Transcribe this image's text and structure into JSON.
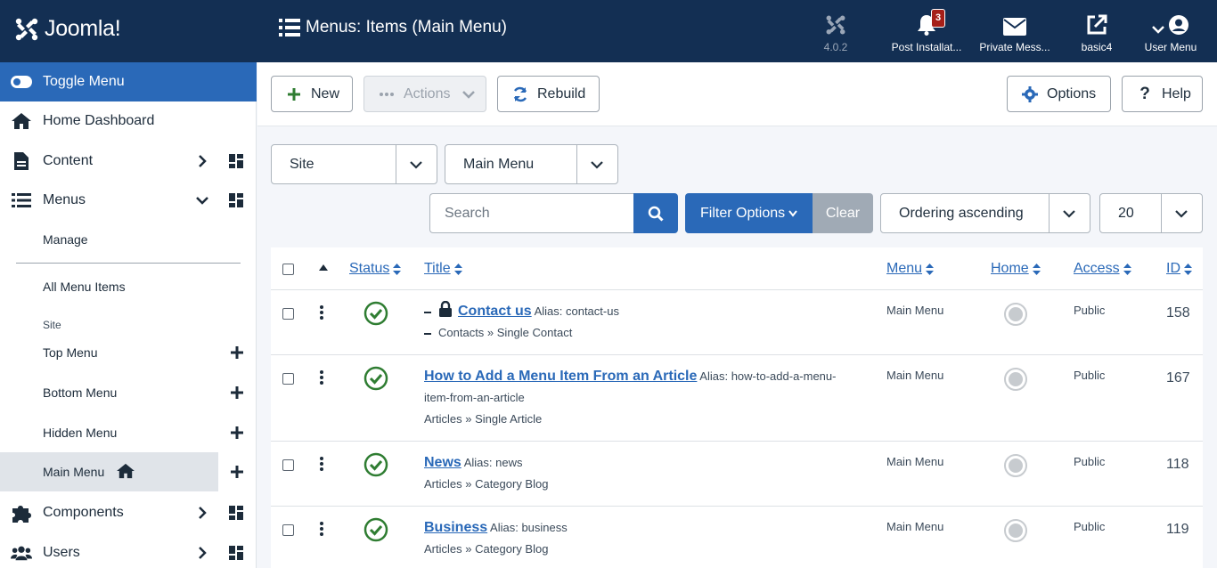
{
  "header": {
    "logo_text": "Joomla!",
    "page_title": "Menus: Items (Main Menu)",
    "items": [
      {
        "label": "4.0.2",
        "icon": "joomla-icon"
      },
      {
        "label": "Post Installat...",
        "icon": "bell-icon",
        "badge": "3"
      },
      {
        "label": "Private Mess...",
        "icon": "envelope-icon"
      },
      {
        "label": "basic4",
        "icon": "external-link-icon"
      },
      {
        "label": "User Menu",
        "icon": "user-icon"
      }
    ]
  },
  "sidebar": {
    "toggle_label": "Toggle Menu",
    "items": [
      {
        "label": "Home Dashboard",
        "icon": "home-icon"
      },
      {
        "label": "Content",
        "icon": "file-icon"
      },
      {
        "label": "Menus",
        "icon": "list-icon"
      },
      {
        "label": "Components",
        "icon": "puzzle-icon"
      },
      {
        "label": "Users",
        "icon": "users-icon"
      }
    ],
    "sub": {
      "manage": "Manage",
      "all_items": "All Menu Items",
      "site_heading": "Site",
      "menus": [
        "Top Menu",
        "Bottom Menu",
        "Hidden Menu",
        "Main Menu"
      ]
    }
  },
  "toolbar": {
    "new": "New",
    "actions": "Actions",
    "rebuild": "Rebuild",
    "options": "Options",
    "help": "Help"
  },
  "filters": {
    "client": "Site",
    "menu": "Main Menu",
    "search_placeholder": "Search",
    "filter_options": "Filter Options",
    "clear": "Clear",
    "ordering": "Ordering ascending",
    "limit": "20"
  },
  "table": {
    "headers": {
      "status": "Status",
      "title": "Title",
      "menu": "Menu",
      "home": "Home",
      "access": "Access",
      "id": "ID"
    },
    "rows": [
      {
        "title": "Contact us",
        "alias": "Alias: contact-us",
        "type": "Contacts » Single Contact",
        "menu": "Main Menu",
        "access": "Public",
        "id": "158"
      },
      {
        "title": "How to Add a Menu Item From an Article",
        "alias": "Alias: how-to-add-a-menu-item-from-an-article",
        "type": "Articles » Single Article",
        "menu": "Main Menu",
        "access": "Public",
        "id": "167"
      },
      {
        "title": "News",
        "alias": "Alias: news",
        "type": "Articles » Category Blog",
        "menu": "Main Menu",
        "access": "Public",
        "id": "118"
      },
      {
        "title": "Business",
        "alias": "Alias: business",
        "type": "Articles » Category Blog",
        "menu": "Main Menu",
        "access": "Public",
        "id": "119"
      }
    ]
  },
  "colors": {
    "header_bg": "#132f53",
    "accent": "#2a69b8",
    "success": "#2f7d32"
  }
}
